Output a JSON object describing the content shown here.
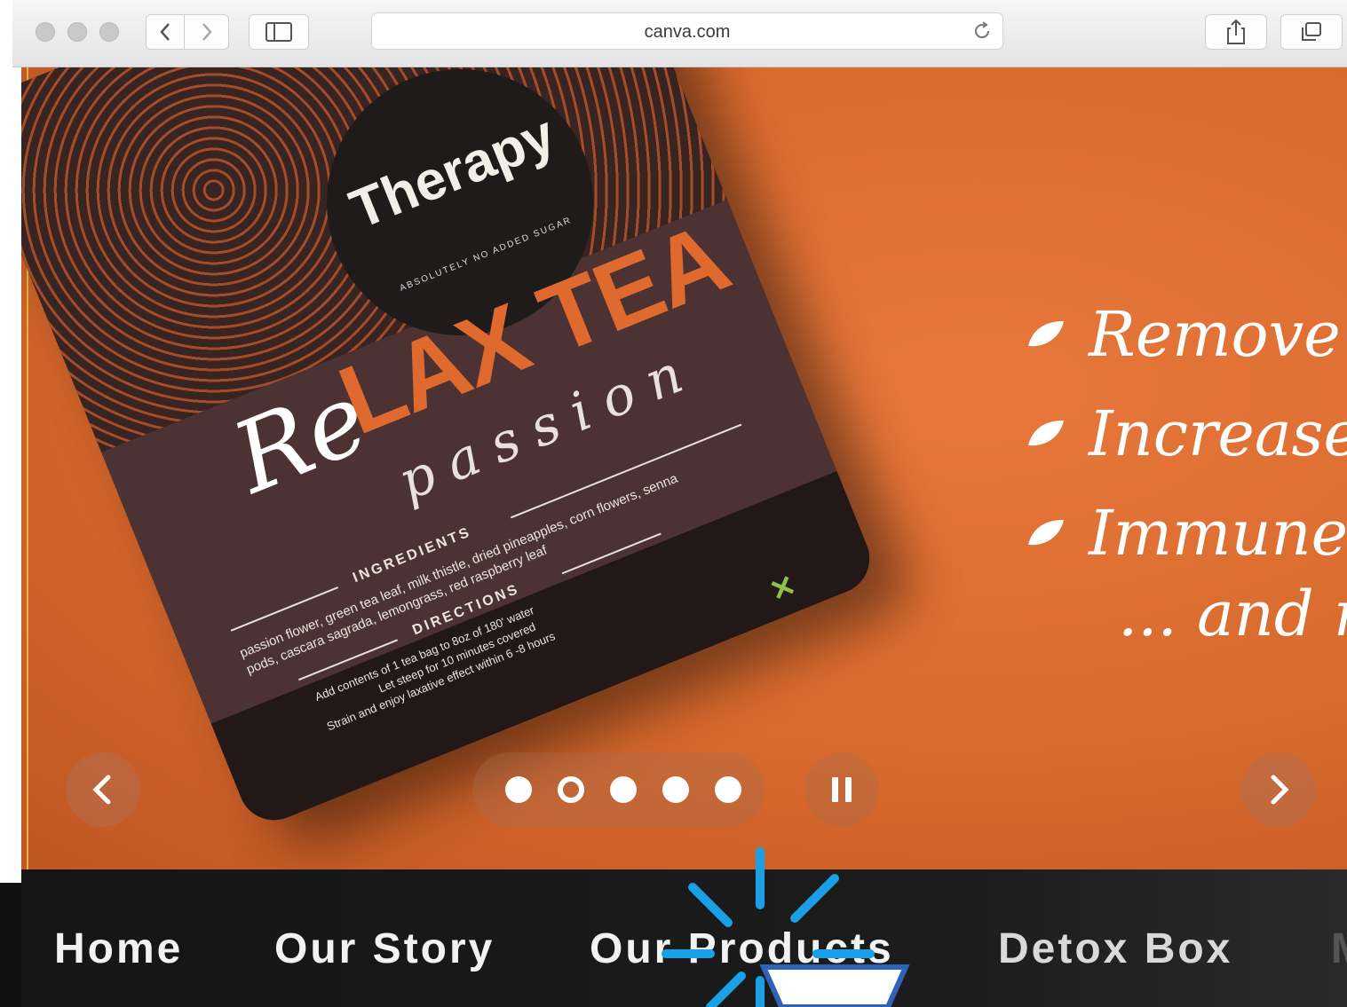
{
  "browser": {
    "url": "canva.com"
  },
  "hero": {
    "product": {
      "brand": "Therapy",
      "brand_subtitle": "ABSOLUTELY NO ADDED SUGAR",
      "title_re": "Re",
      "title_rest": "LAX TEA",
      "subtitle": "passion",
      "ingredients_heading": "INGREDIENTS",
      "ingredients_text": "passion flower, green tea leaf, milk thistle, dried pineapples, corn flowers, senna pods, cascara sagrada, lemongrass, red raspberry leaf",
      "directions_heading": "DIRECTIONS",
      "directions": [
        "Add contents of 1 tea bag to 8oz of 180' water",
        "Let steep for 10 minutes covered",
        "Strain and enjoy laxative effect within 6 -8 hours"
      ]
    },
    "benefits": [
      "Remove to",
      "Increase m",
      "Immune s"
    ],
    "more": "... and m",
    "carousel": {
      "slides_count": 5,
      "active_index": 1,
      "paused": false
    }
  },
  "nav": {
    "items": [
      "Home",
      "Our Story",
      "Our Products",
      "Detox Box",
      "M"
    ]
  },
  "colors": {
    "hero_orange": "#d8692d",
    "nav_background": "#151515",
    "burst_blue": "#19a0e6"
  }
}
